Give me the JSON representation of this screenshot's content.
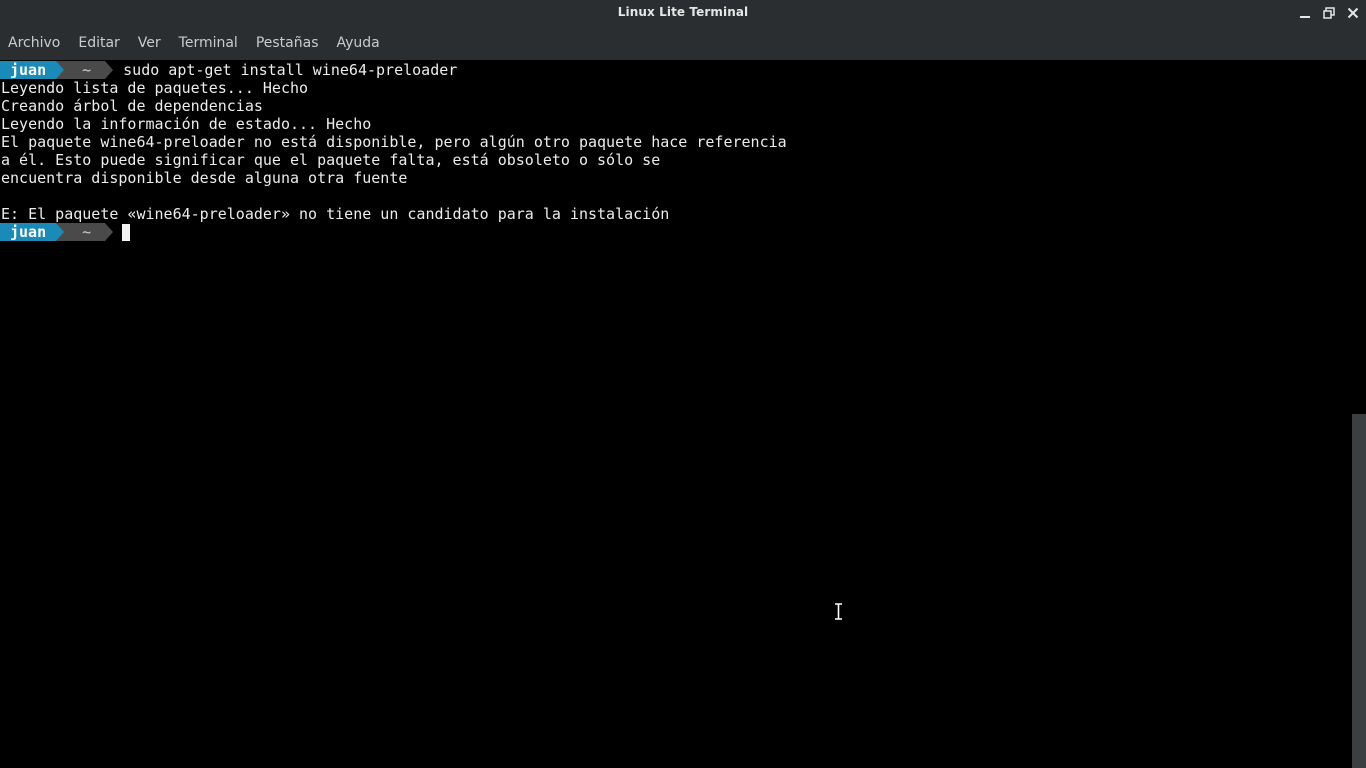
{
  "window": {
    "title": "Linux Lite Terminal",
    "controls": [
      "minimize-icon",
      "maximize-icon",
      "close-icon"
    ]
  },
  "menubar": {
    "items": [
      "Archivo",
      "Editar",
      "Ver",
      "Terminal",
      "Pestañas",
      "Ayuda"
    ]
  },
  "terminal": {
    "prompt": {
      "user": "juan",
      "dir": "~"
    },
    "command": "sudo apt-get install wine64-preloader",
    "output": [
      "Leyendo lista de paquetes... Hecho",
      "Creando árbol de dependencias",
      "Leyendo la información de estado... Hecho",
      "El paquete wine64-preloader no está disponible, pero algún otro paquete hace referencia",
      "a él. Esto puede significar que el paquete falta, está obsoleto o sólo se",
      "encuentra disponible desde alguna otra fuente",
      "",
      "E: El paquete «wine64-preloader» no tiene un candidato para la instalación"
    ]
  },
  "colors": {
    "prompt_user_bg": "#1a8bb8",
    "prompt_dir_bg": "#4a4a4a",
    "chrome_bg": "#2b2e30",
    "terminal_bg": "#000000"
  }
}
